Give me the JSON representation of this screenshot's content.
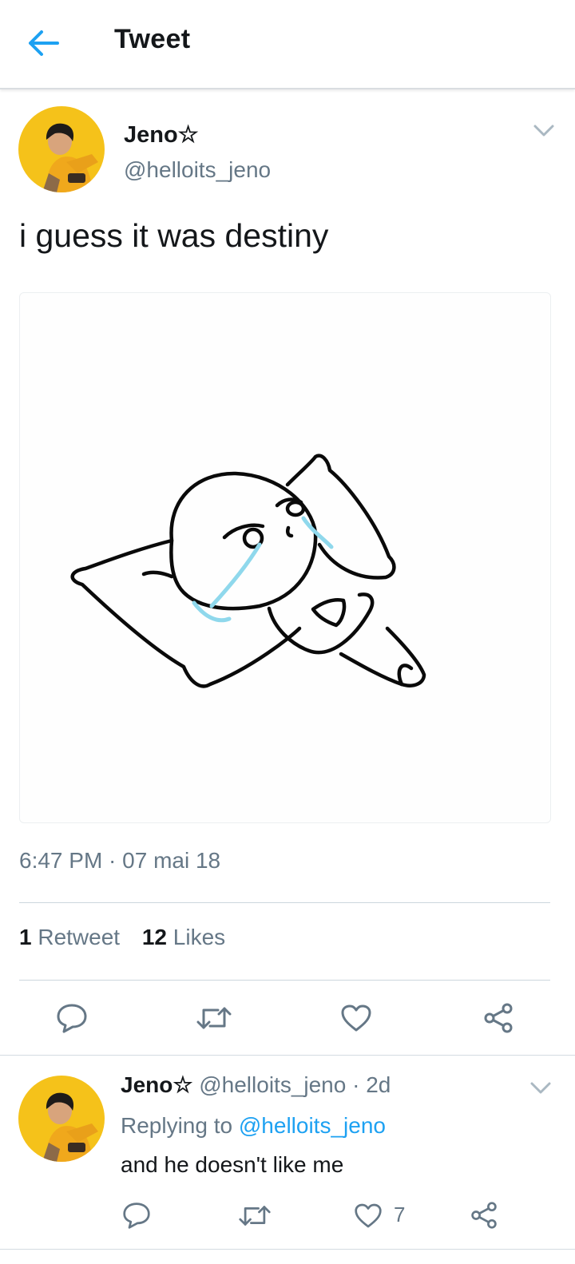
{
  "header": {
    "title": "Tweet",
    "back_icon": "arrow-left-icon",
    "accent": "#1da1f2"
  },
  "tweet": {
    "author_name": "Jeno☆",
    "author_handle": "@helloits_jeno",
    "text": "i guess it was destiny",
    "timestamp": "6:47 PM · 07 mai 18",
    "retweets": {
      "count": "1",
      "label": "Retweet"
    },
    "likes": {
      "count": "12",
      "label": "Likes"
    },
    "actions": [
      "reply-icon",
      "retweet-icon",
      "like-icon",
      "share-icon"
    ]
  },
  "reply": {
    "author_name": "Jeno☆",
    "author_handle": "@helloits_jeno",
    "age": "· 2d",
    "replying_prefix": "Replying to",
    "replying_to": "@helloits_jeno",
    "text": "and he doesn't like me",
    "like_count": "7"
  },
  "colors": {
    "text": "#14171a",
    "secondary": "#657786",
    "divider": "#ccd6dd",
    "avatar_bg": "#f5c21a"
  }
}
